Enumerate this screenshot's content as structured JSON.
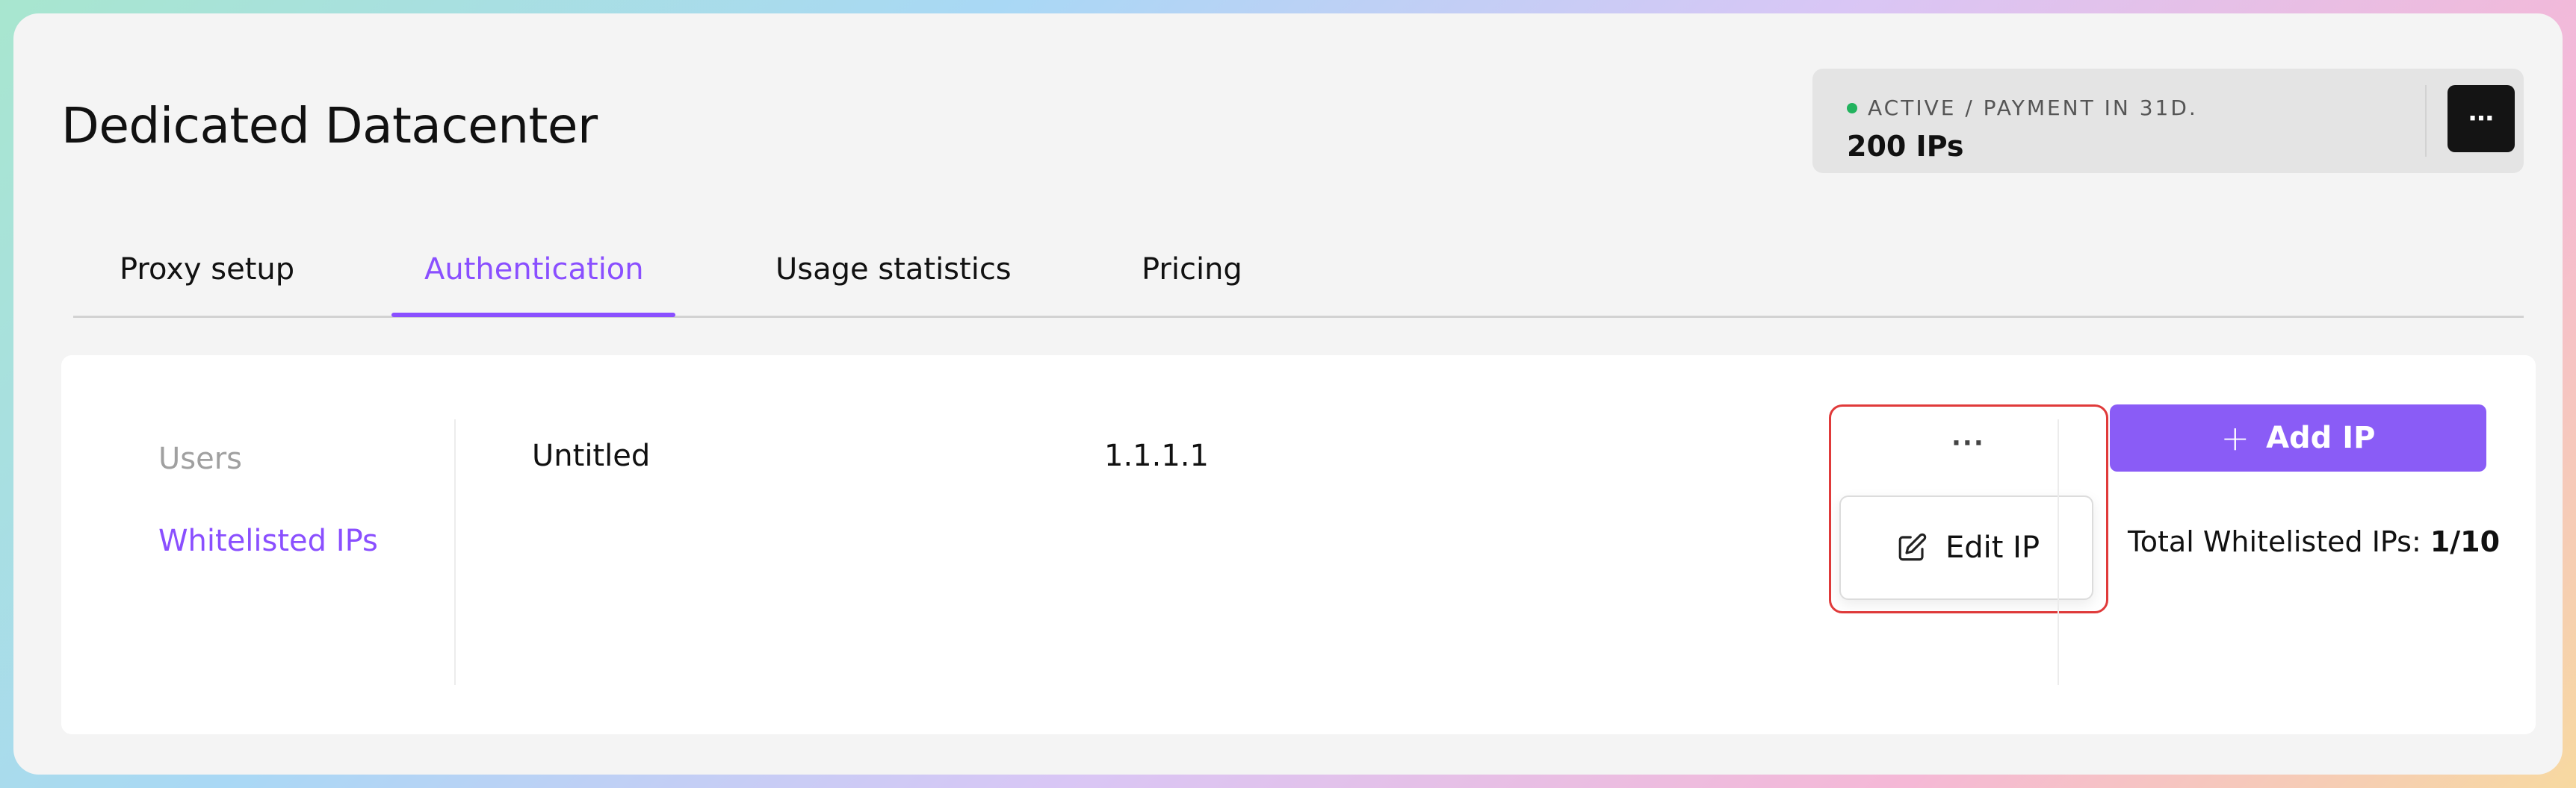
{
  "page": {
    "title": "Dedicated Datacenter"
  },
  "plan": {
    "status": "ACTIVE / PAYMENT IN 31D.",
    "status_color": "#22b35e",
    "ips": "200 IPs",
    "more_label": "⋯"
  },
  "tabs": [
    {
      "label": "Proxy setup",
      "active": false
    },
    {
      "label": "Authentication",
      "active": true
    },
    {
      "label": "Usage statistics",
      "active": false
    },
    {
      "label": "Pricing",
      "active": false
    }
  ],
  "sidebar": {
    "items": [
      {
        "label": "Users",
        "active": false
      },
      {
        "label": "Whitelisted IPs",
        "active": true
      }
    ]
  },
  "whitelist": {
    "rows": [
      {
        "name": "Untitled",
        "ip": "1.1.1.1",
        "menu_label": "···"
      }
    ],
    "row_menu": {
      "items": [
        {
          "label": "Edit IP",
          "icon": "edit-icon"
        }
      ]
    },
    "add_button_label": "Add IP",
    "total_label": "Total Whitelisted IPs: ",
    "total_value": "1/10"
  },
  "colors": {
    "accent": "#8a4fff",
    "button": "#8a5cf6",
    "highlight": "#e03a3a"
  }
}
